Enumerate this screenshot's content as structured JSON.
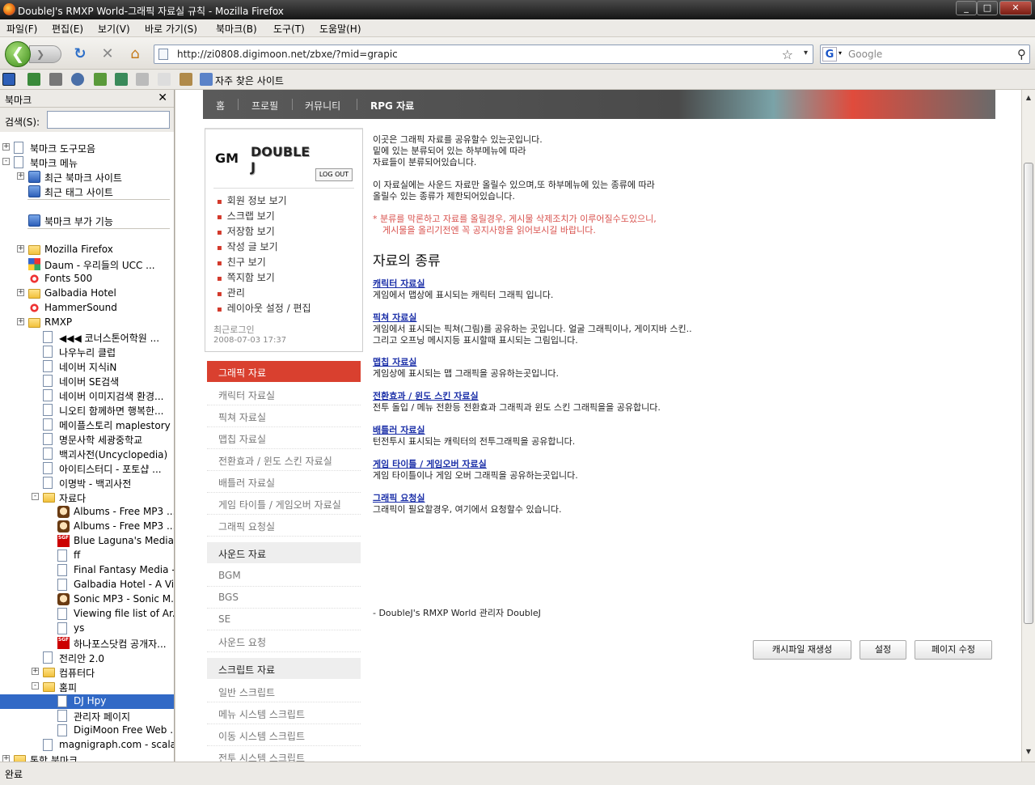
{
  "window": {
    "title": "DoubleJ's RMXP World-그래픽 자료실 규칙 - Mozilla Firefox",
    "minimize": "_",
    "maximize": "□",
    "close": "✕"
  },
  "menu": [
    "파일(F)",
    "편집(E)",
    "보기(V)",
    "바로 가기(S)",
    "북마크(B)",
    "도구(T)",
    "도움말(H)"
  ],
  "nav": {
    "url": "http://zi0808.digimoon.net/zbxe/?mid=grapic",
    "search_placeholder": "Google",
    "back": "❮",
    "forward": "❯",
    "reload": "↻",
    "stop": "✕",
    "home": "⌂",
    "star": "☆",
    "dropdown": "▾",
    "g": "G",
    "search_go": "⚲"
  },
  "bookmarks_toolbar": {
    "label": "자주 찾은 사이트"
  },
  "sidebar": {
    "title": "북마크",
    "close": "✕",
    "search_label": "검색(S):",
    "items": [
      {
        "label": "북마크 도구모음",
        "icon": "bookmarks-toolbar-icon",
        "exp": "+"
      },
      {
        "label": "북마크 메뉴",
        "icon": "bookmarks-menu-icon",
        "exp": "−"
      },
      {
        "label": "최근 북마크 사이트",
        "icon": "smart-folder-icon",
        "exp": "+"
      },
      {
        "label": "최근 태그 사이트",
        "icon": "smart-folder-icon",
        "exp": ""
      },
      {
        "label": "북마크 부가 기능",
        "icon": "addons-icon",
        "exp": ""
      },
      {
        "label": "Mozilla Firefox",
        "icon": "folder-icon",
        "exp": "+"
      },
      {
        "label": "Daum - 우리들의 UCC ...",
        "icon": "daum-icon",
        "exp": ""
      },
      {
        "label": "Fonts 500",
        "icon": "fonts-icon",
        "exp": ""
      },
      {
        "label": "Galbadia Hotel",
        "icon": "folder-icon",
        "exp": "+"
      },
      {
        "label": "HammerSound",
        "icon": "hammersound-icon",
        "exp": ""
      },
      {
        "label": "RMXP",
        "icon": "folder-icon",
        "exp": "+"
      },
      {
        "label": "◀◀◀ 코너스톤어학원 ...",
        "icon": "page-icon",
        "exp": ""
      },
      {
        "label": "나우누리 클럽",
        "icon": "page-icon",
        "exp": ""
      },
      {
        "label": "네이버 지식iN",
        "icon": "page-icon",
        "exp": ""
      },
      {
        "label": "네이버 SE검색",
        "icon": "page-icon",
        "exp": ""
      },
      {
        "label": "네이버 이미지검색 환경...",
        "icon": "page-icon",
        "exp": ""
      },
      {
        "label": "니오티 함께하면 행복한...",
        "icon": "page-icon",
        "exp": ""
      },
      {
        "label": "메이플스토리 maplestory",
        "icon": "page-icon",
        "exp": ""
      },
      {
        "label": "명문사학 세광중학교",
        "icon": "page-icon",
        "exp": ""
      },
      {
        "label": "백괴사전(Uncyclopedia)",
        "icon": "page-icon",
        "exp": ""
      },
      {
        "label": "아이티스터디 - 포토샵 ...",
        "icon": "page-icon",
        "exp": ""
      },
      {
        "label": "이명박 - 백괴사전",
        "icon": "page-icon",
        "exp": ""
      },
      {
        "label": "자료다",
        "icon": "folder-icon",
        "exp": "−"
      },
      {
        "label": "Albums - Free MP3 ...",
        "icon": "face-icon",
        "exp": ""
      },
      {
        "label": "Albums - Free MP3 ...",
        "icon": "face-icon",
        "exp": ""
      },
      {
        "label": "Blue Laguna's Media...",
        "icon": "sgf-icon",
        "exp": ""
      },
      {
        "label": "ff",
        "icon": "page-icon",
        "exp": ""
      },
      {
        "label": "Final Fantasy Media - ...",
        "icon": "page-icon",
        "exp": ""
      },
      {
        "label": "Galbadia Hotel - A Vi...",
        "icon": "page-icon",
        "exp": ""
      },
      {
        "label": "Sonic MP3 - Sonic M...",
        "icon": "face-icon",
        "exp": ""
      },
      {
        "label": "Viewing file list of Ar...",
        "icon": "page-icon",
        "exp": ""
      },
      {
        "label": "ys",
        "icon": "page-icon",
        "exp": ""
      },
      {
        "label": "하나포스닷컴 공개자...",
        "icon": "sgf-icon",
        "exp": ""
      },
      {
        "label": "전리안 2.0",
        "icon": "page-icon",
        "exp": ""
      },
      {
        "label": "컴퓨터다",
        "icon": "folder-icon",
        "exp": "+"
      },
      {
        "label": "홈피",
        "icon": "folder-icon",
        "exp": "−"
      },
      {
        "label": "DJ Hpy",
        "icon": "page-icon",
        "exp": ""
      },
      {
        "label": "관리자 페이지",
        "icon": "page-icon",
        "exp": ""
      },
      {
        "label": "DigiMoon Free Web ...",
        "icon": "page-icon",
        "exp": ""
      },
      {
        "label": "magnigraph.com - scala...",
        "icon": "page-icon",
        "exp": ""
      },
      {
        "label": "통합 북마크",
        "icon": "folder-icon",
        "exp": "+"
      }
    ]
  },
  "site": {
    "nav": [
      "홈",
      "프로필",
      "커뮤니티",
      "RPG 자료"
    ],
    "login": {
      "logo_gm": "GM",
      "logo_name": "DOUBLE J",
      "logout": "LOG OUT",
      "menu": [
        "회원 정보 보기",
        "스크랩 보기",
        "저장함 보기",
        "작성 글 보기",
        "친구 보기",
        "쪽지함 보기",
        "관리",
        "레이아웃 설정 / 편집"
      ],
      "last_login_label": "최근로그인",
      "last_login": "2008-07-03 17:37"
    },
    "categories": {
      "graphic": "그래픽 자료",
      "graphic_items": [
        "캐릭터 자료실",
        "픽쳐 자료실",
        "맵칩 자료실",
        "전환효과 / 윈도 스킨 자료실",
        "배틀러 자료실",
        "게임 타이틀 / 게임오버 자료실",
        "그래픽 요청실"
      ],
      "sound": "사운드 자료",
      "sound_items": [
        "BGM",
        "BGS",
        "SE",
        "사운드 요청"
      ],
      "script": "스크립트 자료",
      "script_items": [
        "일반 스크립트",
        "메뉴 시스템 스크립트",
        "이동 시스템 스크립트",
        "전투 시스템 스크립트"
      ]
    },
    "intro": [
      "이곳은 그래픽 자료를 공유할수 있는곳입니다.",
      "밑에 있는 분류되어 있는 하부메뉴에 따라",
      "자료들이 분류되어있습니다.",
      "이 자료실에는 사운드 자료만 올릴수 있으며,또 하부메뉴에 있는 종류에 따라",
      "올릴수 있는 종류가 제한되어있습니다."
    ],
    "warning": [
      "* 분류를 막론하고 자료를 올릴경우, 게시물 삭제조치가 이루어질수도있으니,",
      "게시물을 올리기전엔 꼭 공지사항을 읽어보시길 바랍니다."
    ],
    "heading": "자료의 종류",
    "kinds": [
      {
        "title": "캐릭터 자료실",
        "desc": [
          "게임에서 맵상에 표시되는 캐릭터 그래픽 입니다."
        ]
      },
      {
        "title": "픽쳐 자료실",
        "desc": [
          "게임에서 표시되는 픽쳐(그림)를 공유하는 곳입니다. 얼굴 그래픽이나, 게이지바 스킨..",
          "그리고 오프닝 메시지등 표시할때 표시되는 그림입니다."
        ]
      },
      {
        "title": "맵칩 자료실",
        "desc": [
          "게임상에 표시되는 맵 그래픽을 공유하는곳입니다."
        ]
      },
      {
        "title": "전환효과  / 윈도 스킨 자료실",
        "desc": [
          "전투 돌입 / 메뉴 전환등 전환효과 그래픽과 윈도 스킨 그래픽을을 공유합니다."
        ]
      },
      {
        "title": "배틀러 자료실",
        "desc": [
          "턴전투시 표시되는 캐릭터의 전투그래픽을 공유합니다."
        ]
      },
      {
        "title": "게임 타이틀 / 게임오버 자료실",
        "desc": [
          "게임 타이틀이나 게임 오버 그래픽을 공유하는곳입니다."
        ]
      },
      {
        "title": "그래픽 요청실",
        "desc": [
          "그래픽이 필요할경우, 여기에서 요청할수 있습니다."
        ]
      }
    ],
    "signature": "- DoubleJ's RMXP World 관리자 DoubleJ",
    "buttons": [
      "캐시파일 재생성",
      "설정",
      "페이지 수정"
    ]
  },
  "status": "완료"
}
